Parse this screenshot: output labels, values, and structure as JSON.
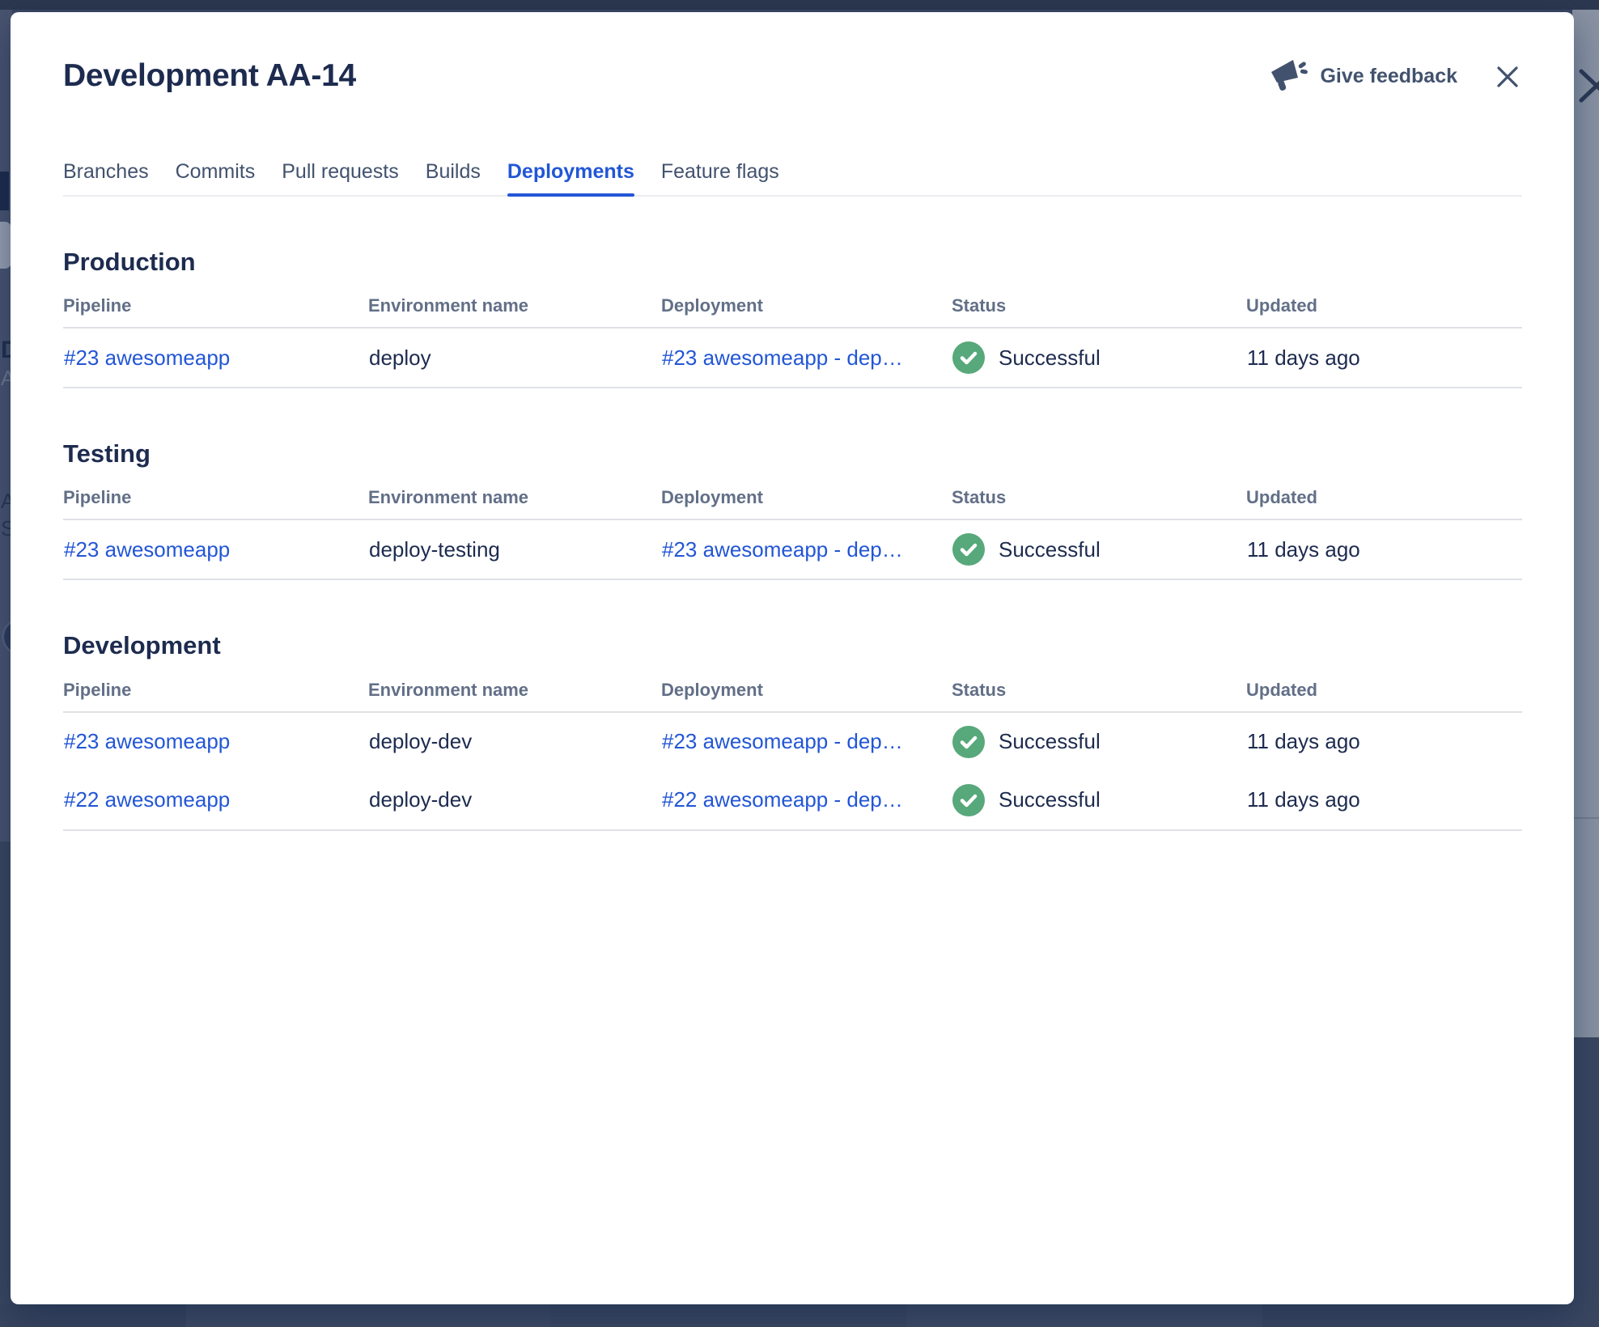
{
  "modal": {
    "title": "Development AA-14",
    "feedback_label": "Give feedback"
  },
  "tabs": [
    {
      "label": "Branches",
      "active": false
    },
    {
      "label": "Commits",
      "active": false
    },
    {
      "label": "Pull requests",
      "active": false
    },
    {
      "label": "Builds",
      "active": false
    },
    {
      "label": "Deployments",
      "active": true
    },
    {
      "label": "Feature flags",
      "active": false
    }
  ],
  "columns": [
    "Pipeline",
    "Environment name",
    "Deployment",
    "Status",
    "Updated"
  ],
  "sections": [
    {
      "heading": "Production",
      "rows": [
        {
          "pipeline": "#23 awesomeapp",
          "environment": "deploy",
          "deployment": "#23 awesomeapp - dep…",
          "status": "Successful",
          "updated": "11 days ago"
        }
      ]
    },
    {
      "heading": "Testing",
      "rows": [
        {
          "pipeline": "#23 awesomeapp",
          "environment": "deploy-testing",
          "deployment": "#23 awesomeapp - dep…",
          "status": "Successful",
          "updated": "11 days ago"
        }
      ]
    },
    {
      "heading": "Development",
      "rows": [
        {
          "pipeline": "#23 awesomeapp",
          "environment": "deploy-dev",
          "deployment": "#23 awesomeapp - dep…",
          "status": "Successful",
          "updated": "11 days ago"
        },
        {
          "pipeline": "#22 awesomeapp",
          "environment": "deploy-dev",
          "deployment": "#22 awesomeapp - dep…",
          "status": "Successful",
          "updated": "11 days ago"
        }
      ]
    }
  ],
  "icons": {
    "feedback": "megaphone-icon",
    "modal_close": "x-icon",
    "status_success": "check-circle-icon",
    "background_close": "x-icon"
  },
  "colors": {
    "accent_blue": "#2256D6",
    "success_green": "#57A87A",
    "text_dark": "#1D2B4F",
    "text_muted": "#626F87",
    "tab_inactive": "#42526E",
    "divider": "#DFE1E6",
    "backdrop": "#3B4761"
  }
}
